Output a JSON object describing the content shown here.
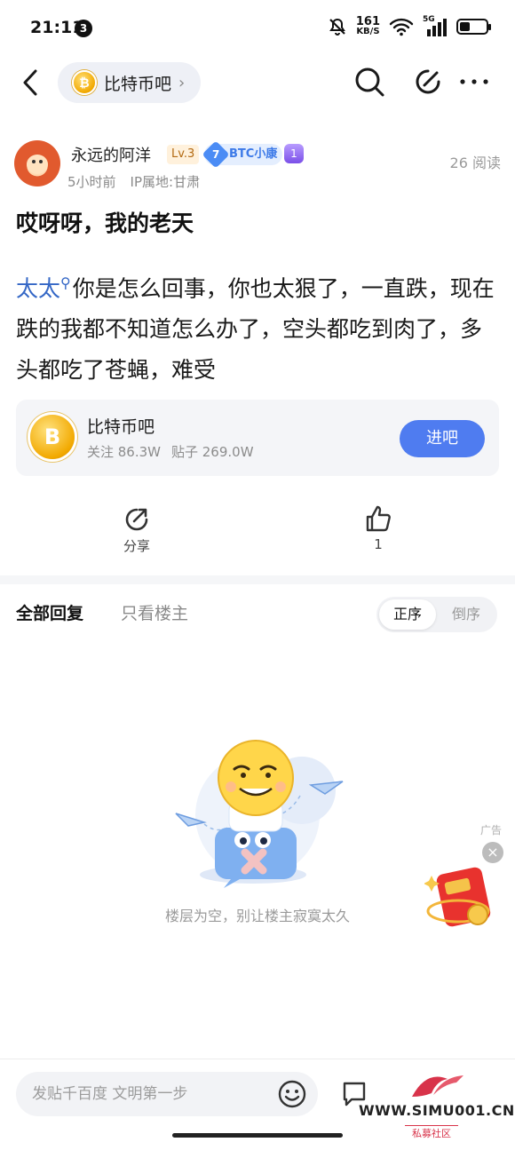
{
  "status_bar": {
    "time": "21:11",
    "notification_count": "3",
    "net_speed_value": "161",
    "net_speed_unit": "KB/S",
    "network": "5G",
    "battery_level": 0.4
  },
  "nav": {
    "forum_name": "比特币吧",
    "forum_chevron": "›"
  },
  "author": {
    "name": "永远的阿洋",
    "level": "Lv.3",
    "badge_num": "7",
    "badge_text": "BTC小康",
    "crown_num": "1",
    "time_ago": "5小时前",
    "ip_location": "IP属地:甘肃",
    "read_count": "26 阅读"
  },
  "post": {
    "title": "哎呀呀，我的老天",
    "body_link": "太太",
    "body_text": "你是怎么回事，你也太狠了，一直跌，现在跌的我都不知道怎么办了，空头都吃到肉了，多头都吃了苍蝇，难受"
  },
  "forum_card": {
    "coin_symbol": "B",
    "name": "比特币吧",
    "followers": "关注 86.3W",
    "posts": "贴子 269.0W",
    "enter_label": "进吧"
  },
  "actions": {
    "share_label": "分享",
    "like_count": "1"
  },
  "replies": {
    "tab_all": "全部回复",
    "tab_host_only": "只看楼主",
    "sort_asc": "正序",
    "sort_desc": "倒序",
    "empty_text": "楼层为空，别让楼主寂寞太久"
  },
  "ad": {
    "label": "广告",
    "close_glyph": "×"
  },
  "bottom": {
    "input_placeholder": "发贴千百度 文明第一步"
  },
  "watermark": {
    "url": "WWW.SIMU001.CN",
    "tag": "私募社区"
  },
  "colors": {
    "accent_blue": "#4f7cf0",
    "link_blue": "#3467c6",
    "coin_gold": "#f2a900",
    "watermark_red": "#d8334a"
  }
}
